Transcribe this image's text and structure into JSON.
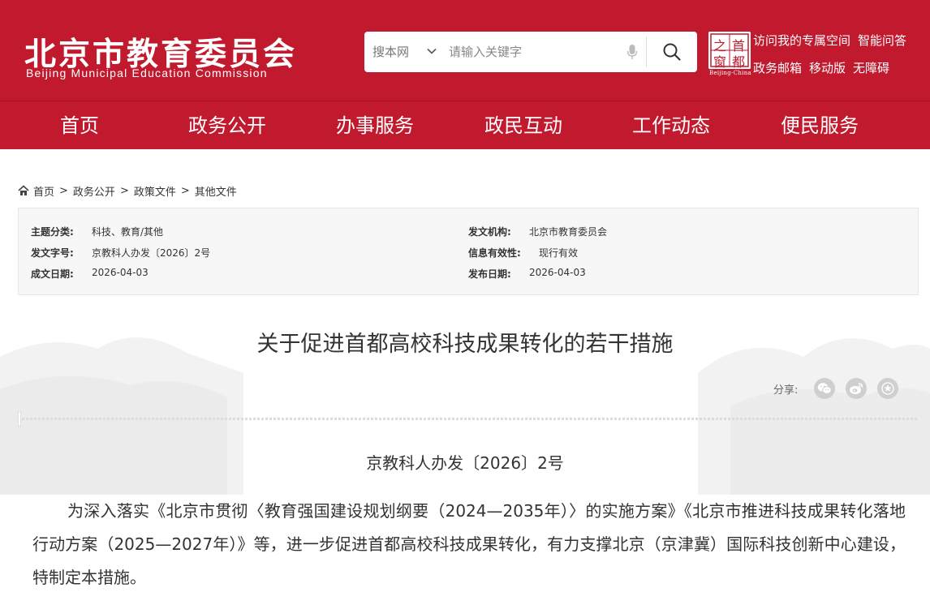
{
  "header": {
    "logo_cn": "北京市教育委员会",
    "logo_en": "Beijing Municipal Education Commission",
    "search": {
      "scope": "搜本网",
      "placeholder": "请输入关键字"
    },
    "seal": {
      "chars": [
        "之",
        "首",
        "窗",
        "都"
      ],
      "caption": "Beijing-China"
    },
    "links_row1": [
      "访问我的专属空间",
      "智能问答"
    ],
    "links_row2": [
      "政务邮箱",
      "移动版",
      "无障碍"
    ],
    "brand_color": "#c1192d"
  },
  "nav": {
    "items": [
      "首页",
      "政务公开",
      "办事服务",
      "政民互动",
      "工作动态",
      "便民服务"
    ]
  },
  "breadcrumb": [
    "首页",
    "政务公开",
    "政策文件",
    "其他文件"
  ],
  "info": {
    "topic_label": "主题分类:",
    "topic_value": "科技、教育/其他",
    "docno_label": "发文字号:",
    "docno_value": "京教科人办发〔2026〕2号",
    "written_label": "成文日期:",
    "written_value": "2026-04-03",
    "org_label": "发文机构:",
    "org_value": "北京市教育委员会",
    "validity_label": "信息有效性:",
    "validity_value": "现行有效",
    "publish_label": "发布日期:",
    "publish_value": "2026-04-03"
  },
  "article": {
    "title": "关于促进首都高校科技成果转化的若干措施",
    "share_label": "分享:",
    "share_icons": [
      "wechat-icon",
      "weibo-icon",
      "favorite-icon"
    ],
    "doc_number": "京教科人办发〔2026〕2号",
    "paragraph_1": "为深入落实《北京市贯彻〈教育强国建设规划纲要（2024—2035年）〉的实施方案》《北京市推进科技成果转化落地行动方案（2025—2027年）》等，进一步促进首都高校科技成果转化，有力支撑北京（京津冀）国际科技创新中心建设，特制定本措施。"
  }
}
